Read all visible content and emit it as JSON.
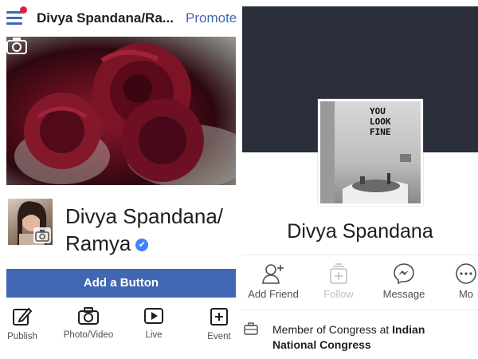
{
  "left": {
    "topbar": {
      "title": "Divya Spandana/Ra...",
      "promote": "Promote"
    },
    "profile": {
      "name_line1": "Divya Spandana/",
      "name_line2": "Ramya",
      "verified_glyph": "✔"
    },
    "add_button": "Add a Button",
    "actions": [
      {
        "label": "Publish",
        "icon": "edit-icon"
      },
      {
        "label": "Photo/Video",
        "icon": "camera-icon"
      },
      {
        "label": "Live",
        "icon": "play-icon"
      },
      {
        "label": "Event",
        "icon": "add-event-icon"
      }
    ]
  },
  "right": {
    "photo_text": "YOU\nLOOK\nFINE",
    "name": "Divya Spandana",
    "actions": [
      {
        "label": "Add Friend",
        "icon": "add-friend-icon",
        "enabled": true
      },
      {
        "label": "Follow",
        "icon": "follow-icon",
        "enabled": false
      },
      {
        "label": "Message",
        "icon": "messenger-icon",
        "enabled": true
      },
      {
        "label": "Mo",
        "icon": "more-icon",
        "enabled": true
      }
    ],
    "info": {
      "prefix": "Member of Congress at ",
      "org": "Indian National Congress"
    }
  },
  "colors": {
    "brand": "#4267b2",
    "cover_dark": "#2b2f3b",
    "muted": "#4b4f56",
    "disabled": "#bec3c9",
    "badge": "#4080ff"
  }
}
